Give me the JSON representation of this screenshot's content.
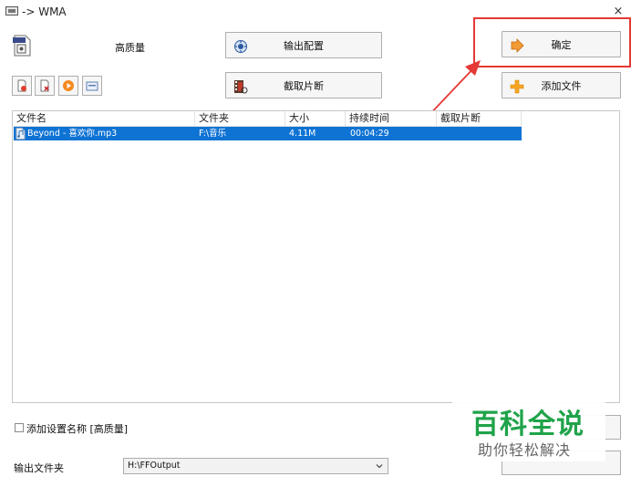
{
  "window": {
    "title": "-> WMA",
    "close_glyph": "×"
  },
  "profile": {
    "quality": "高质量"
  },
  "buttons": {
    "output_config": "输出配置",
    "clip_segment": "截取片断",
    "ok": "确定",
    "add_file": "添加文件"
  },
  "small_toolbar": [
    "remove-file-icon",
    "clear-list-icon",
    "play-icon",
    "info-icon"
  ],
  "file_list": {
    "columns": [
      "文件名",
      "文件夹",
      "大小",
      "持续时间",
      "截取片断"
    ],
    "rows": [
      {
        "name": "Beyond - 喜欢你.mp3",
        "folder": "F:\\音乐",
        "size": "4.11M",
        "duration": "00:04:29",
        "clip": ""
      }
    ]
  },
  "add_setting_name": {
    "label": "添加设置名称 [高质量]",
    "checked": false
  },
  "output_folder": {
    "label": "输出文件夹",
    "value": "H:\\FFOutput"
  },
  "watermark": {
    "title": "百科全说",
    "subtitle": "助你轻松解决"
  },
  "colors": {
    "selection": "#0f73d4",
    "annotation": "#e53935",
    "watermark": "#1fa34a"
  }
}
